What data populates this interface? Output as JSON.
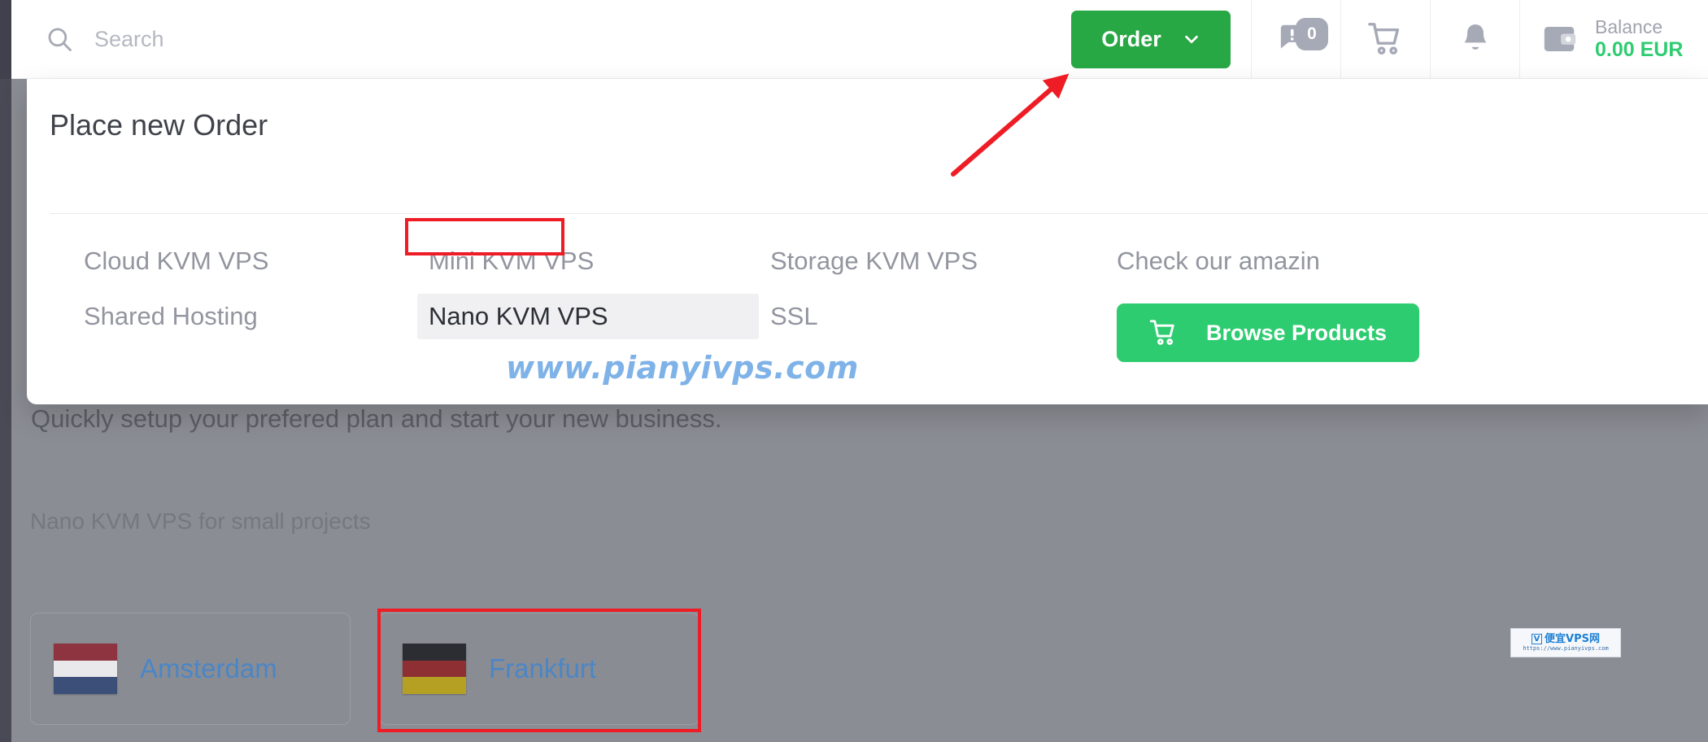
{
  "header": {
    "search": {
      "placeholder": "Search",
      "value": "",
      "icon": "search-icon"
    },
    "order_button": {
      "label": "Order",
      "icon": "chevron-down-icon",
      "color": "#28a745"
    },
    "tickets": {
      "icon": "message-alert-icon",
      "badge": "0"
    },
    "cart": {
      "icon": "shopping-cart-icon"
    },
    "notifications": {
      "icon": "bell-icon"
    },
    "balance": {
      "icon": "wallet-icon",
      "label": "Balance",
      "value": "0.00 EUR",
      "color": "#2ecc71"
    }
  },
  "dropdown": {
    "title": "Place new Order",
    "columns": [
      {
        "items": [
          {
            "label": "Cloud KVM VPS",
            "state": "normal"
          },
          {
            "label": "Shared Hosting",
            "state": "normal"
          }
        ]
      },
      {
        "items": [
          {
            "label": "Mini KVM VPS",
            "state": "normal"
          },
          {
            "label": "Nano KVM VPS",
            "state": "hovered"
          }
        ]
      },
      {
        "items": [
          {
            "label": "Storage KVM VPS",
            "state": "normal"
          },
          {
            "label": "SSL",
            "state": "normal"
          }
        ]
      }
    ],
    "promo": {
      "text": "Check our amazin",
      "button_label": "Browse Products",
      "button_icon": "shopping-cart-icon",
      "button_color": "#2ecc71"
    }
  },
  "page": {
    "subtitle": "Quickly setup your prefered plan and start your new business.",
    "section_label": "Nano KVM VPS for small projects",
    "locations": [
      {
        "name": "Amsterdam",
        "flag": "netherlands-flag",
        "flag_colors": [
          "#8e3440",
          "#e9e9ec",
          "#3b4f79"
        ],
        "highlighted": false
      },
      {
        "name": "Frankfurt",
        "flag": "germany-flag",
        "flag_colors": [
          "#2b2d33",
          "#8e2f33",
          "#b6a024"
        ],
        "highlighted": true
      }
    ],
    "link_color": "#4a86c7"
  },
  "annotations": {
    "arrow_color": "#ee1c25",
    "box_color": "#ee1c25",
    "watermark_text": "www.pianyivps.com",
    "watermark_color": "#7fb3e8",
    "badge": {
      "logo_letter": "V",
      "name": "便宜VPS网",
      "url": "https://www.pianyivps.com"
    }
  }
}
